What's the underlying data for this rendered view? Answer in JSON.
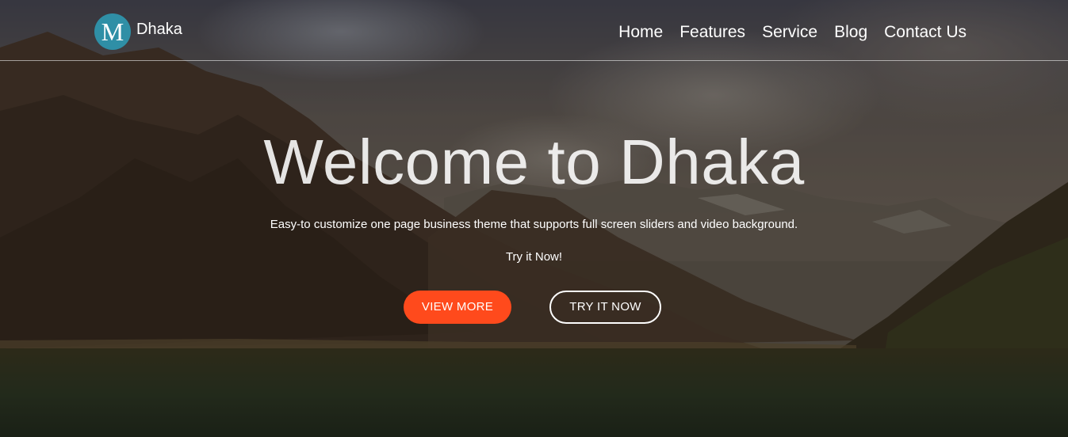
{
  "brand": {
    "logo_letter": "M",
    "name": "Dhaka",
    "badge_color": "#2f8fa6"
  },
  "nav": {
    "items": [
      {
        "label": "Home"
      },
      {
        "label": "Features"
      },
      {
        "label": "Service"
      },
      {
        "label": "Blog"
      },
      {
        "label": "Contact Us"
      }
    ]
  },
  "hero": {
    "title": "Welcome to Dhaka",
    "subtitle": "Easy-to customize one page business theme that supports full screen sliders and video background.",
    "tagline": "Try it Now!",
    "primary_button": "VIEW MORE",
    "secondary_button": "TRY IT NOW",
    "primary_color": "#ff4a1c",
    "background": "mountain-lake-photo"
  }
}
